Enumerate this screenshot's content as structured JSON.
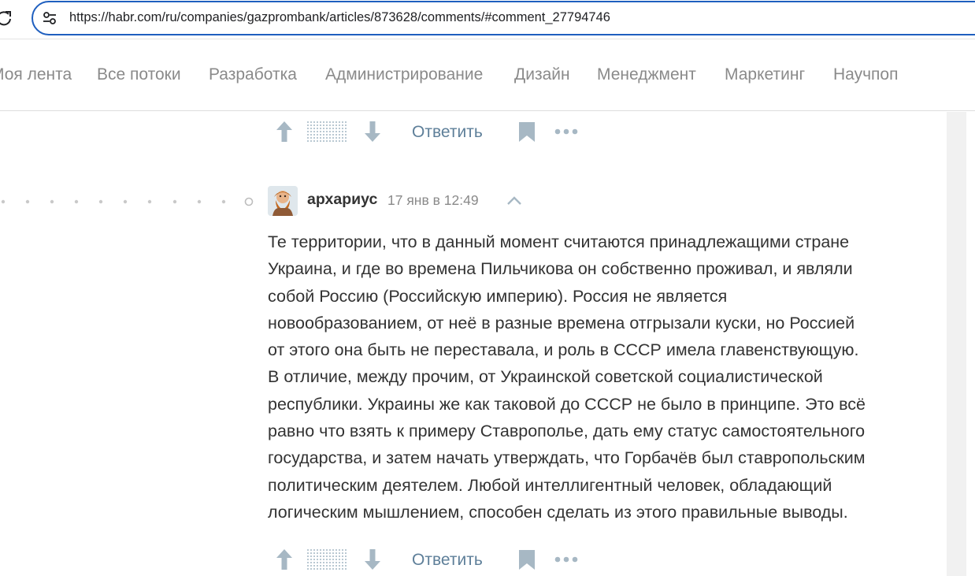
{
  "browser": {
    "url": "https://habr.com/ru/companies/gazprombank/articles/873628/comments/#comment_27794746"
  },
  "nav": {
    "items": [
      "Моя лента",
      "Все потоки",
      "Разработка",
      "Администрирование",
      "Дизайн",
      "Менеджмент",
      "Маркетинг",
      "Научпоп"
    ]
  },
  "previous_comment_actions": {
    "reply_label": "Ответить"
  },
  "comment": {
    "author": "архариус",
    "timestamp": "17 янв в 12:49",
    "body_lines": [
      "Те территории, что в данный момент считаются принадлежащими стране",
      "Украина, и где во времена Пильчикова он собственно проживал, и являли",
      "собой Россию (Российскую империю). Россия не является",
      "новообразованием, от неё в разные времена отгрызали куски, но Россией",
      "от этого она быть не переставала, и роль в СССР имела главенствующую.",
      "В отличие, между прочим, от Украинской советской социалистической",
      "республики. Украины же как таковой до СССР не было в принципе. Это всё",
      "равно что взять к примеру Ставрополье, дать ему статус самостоятельного",
      "государства, и затем начать утверждать, что Горбачёв был ставропольским",
      "политическим деятелем. Любой интеллигентный человек, обладающий",
      "логическим мышлением, способен сделать из этого правильные выводы."
    ],
    "reply_label": "Ответить"
  },
  "icons": {
    "upvote": "arrow-up-icon",
    "downvote": "arrow-down-icon",
    "rating": "rating-hidden-icon",
    "bookmark": "bookmark-icon",
    "more": "more-dots-icon",
    "collapse": "chevron-up-icon"
  },
  "colors": {
    "url_focus_border": "#1f5fbf",
    "nav_text": "#8a8a8a",
    "reply_link": "#5e7f99",
    "icon_gray": "#a7b8c4"
  }
}
